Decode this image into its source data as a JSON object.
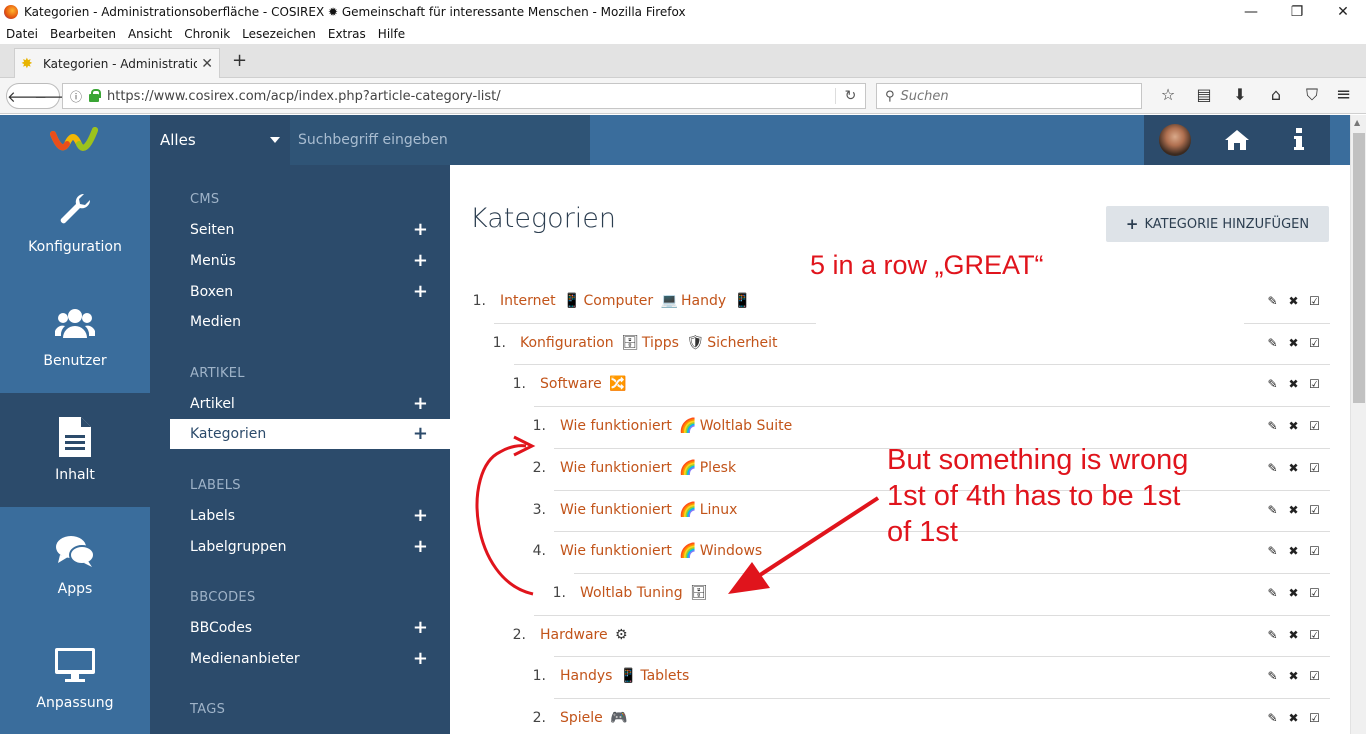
{
  "window": {
    "title": "Kategorien - Administrationsoberfläche - COSIREX ✹ Gemeinschaft für interessante Menschen - Mozilla Firefox"
  },
  "menubar": [
    "Datei",
    "Bearbeiten",
    "Ansicht",
    "Chronik",
    "Lesezeichen",
    "Extras",
    "Hilfe"
  ],
  "tab": {
    "label": "Kategorien - Administration"
  },
  "url": "https://www.cosirex.com/acp/index.php?article-category-list/",
  "search": {
    "placeholder": "Suchen"
  },
  "acp_header": {
    "search_scope": "Alles",
    "search_placeholder": "Suchbegriff eingeben"
  },
  "sidebar": [
    {
      "label": "Konfiguration",
      "icon": "wrench-icon"
    },
    {
      "label": "Benutzer",
      "icon": "users-icon"
    },
    {
      "label": "Inhalt",
      "icon": "document-icon",
      "active": true
    },
    {
      "label": "Apps",
      "icon": "chat-bubbles-icon"
    },
    {
      "label": "Anpassung",
      "icon": "monitor-icon"
    }
  ],
  "submenu": {
    "cms": "CMS",
    "seiten": "Seiten",
    "menus": "Menüs",
    "boxen": "Boxen",
    "medien": "Medien",
    "artikel_head": "ARTIKEL",
    "artikel": "Artikel",
    "kategorien": "Kategorien",
    "labels_head": "LABELS",
    "labels": "Labels",
    "labelgruppen": "Labelgruppen",
    "bbcodes_head": "BBCODES",
    "bbcodes": "BBCodes",
    "medienanbieter": "Medienanbieter",
    "tags_head": "TAGS"
  },
  "page": {
    "title": "Kategorien",
    "add_button": "KATEGORIE HINZUFÜGEN"
  },
  "categories": [
    {
      "num": "1.",
      "parts": [
        "Internet",
        "📱",
        "Computer",
        "💻",
        "Handy",
        "📱"
      ]
    },
    {
      "num": "1.",
      "parts": [
        "Konfiguration",
        "🗄",
        "Tipps",
        "🛡",
        "Sicherheit"
      ]
    },
    {
      "num": "1.",
      "parts": [
        "Software",
        "🔀"
      ]
    },
    {
      "num": "1.",
      "parts": [
        "Wie funktioniert",
        "🌈",
        "Woltlab Suite"
      ]
    },
    {
      "num": "2.",
      "parts": [
        "Wie funktioniert",
        "🌈",
        "Plesk"
      ]
    },
    {
      "num": "3.",
      "parts": [
        "Wie funktioniert",
        "🌈",
        "Linux"
      ]
    },
    {
      "num": "4.",
      "parts": [
        "Wie funktioniert",
        "🌈",
        "Windows"
      ]
    },
    {
      "num": "1.",
      "parts": [
        "Woltlab Tuning",
        "🗄"
      ]
    },
    {
      "num": "2.",
      "parts": [
        "Hardware",
        "⚙"
      ]
    },
    {
      "num": "1.",
      "parts": [
        "Handys",
        "📱",
        "Tablets"
      ]
    },
    {
      "num": "2.",
      "parts": [
        "Spiele",
        "🎮"
      ]
    }
  ],
  "annotations": {
    "great": "5 in a row „GREAT“",
    "wrong": "But something is wrong\n1st of 4th has to be 1st\nof 1st"
  },
  "colors": {
    "acp_blue": "#3a6d9c",
    "acp_dark": "#2c4b6b",
    "link": "#c2541a",
    "annotation": "#e0141c"
  }
}
